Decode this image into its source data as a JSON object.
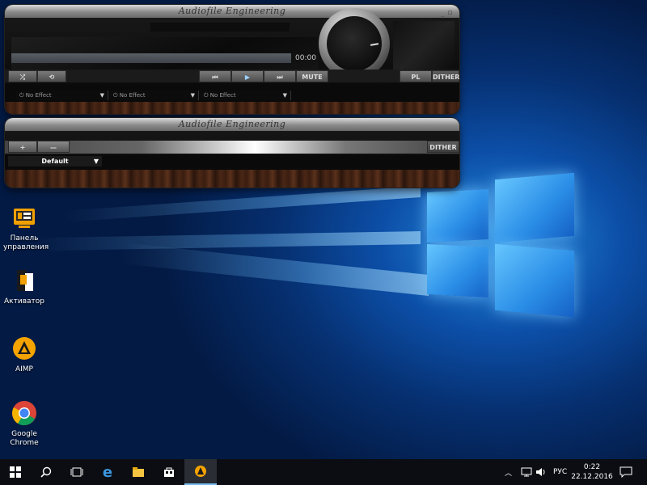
{
  "player": {
    "title": "Audiofile Engineering",
    "time": "00:00",
    "buttons": {
      "mute": "MUTE",
      "pl": "PL",
      "dither": "DITHER"
    },
    "effects": [
      "No Effect",
      "No Effect",
      "No Effect"
    ]
  },
  "eq": {
    "title": "Audiofile Engineering",
    "dither": "DITHER",
    "preset": "Default",
    "plus": "+",
    "minus": "—"
  },
  "desktop_icons": [
    {
      "label": "Панель управления",
      "icon": "control-panel-icon"
    },
    {
      "label": "Активатор",
      "icon": "activator-icon"
    },
    {
      "label": "AIMP",
      "icon": "aimp-icon"
    },
    {
      "label": "Google Chrome",
      "icon": "chrome-icon"
    }
  ],
  "taskbar": {
    "lang": "РУС",
    "time": "0:22",
    "date": "22.12.2016"
  },
  "colors": {
    "accent": "#1e88e5",
    "aimp_orange": "#f5a300"
  }
}
